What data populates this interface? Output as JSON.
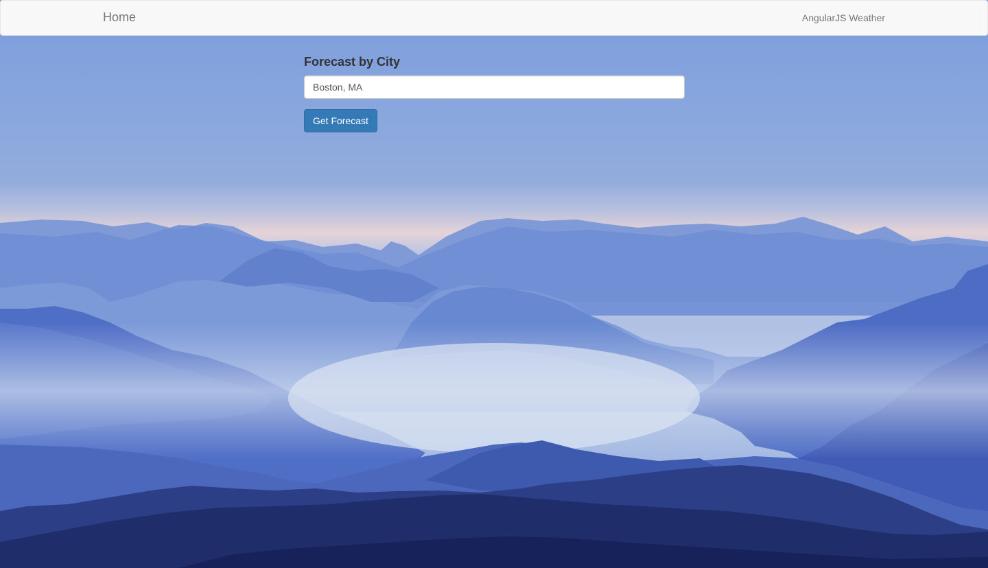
{
  "navbar": {
    "brand_label": "Home",
    "app_title": "AngularJS Weather"
  },
  "form": {
    "label": "Forecast by City",
    "city_value": "Boston, MA",
    "submit_label": "Get Forecast"
  },
  "colors": {
    "primary_button": "#337ab7",
    "navbar_bg": "#f8f8f8",
    "navbar_text": "#777777",
    "label_text": "#333333"
  },
  "background": {
    "icon": "misty-mountains-photo"
  }
}
